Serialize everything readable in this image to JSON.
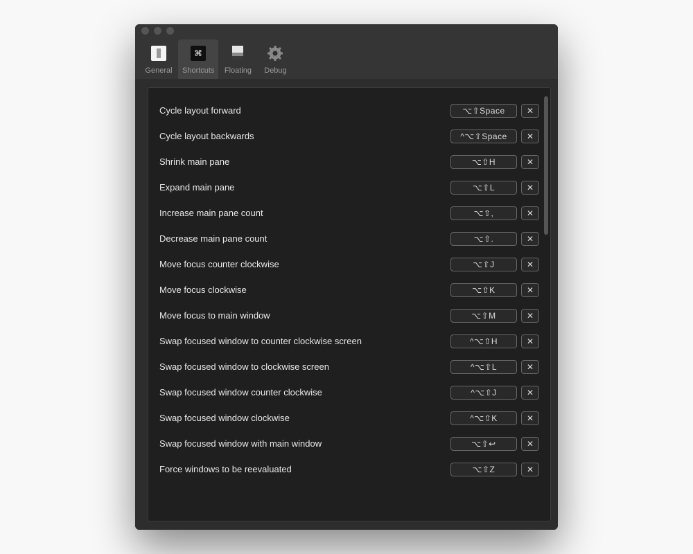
{
  "toolbar": {
    "tabs": [
      {
        "label": "General"
      },
      {
        "label": "Shortcuts"
      },
      {
        "label": "Floating"
      },
      {
        "label": "Debug"
      }
    ],
    "selected_index": 1
  },
  "shortcuts": [
    {
      "label": "Cycle layout forward",
      "keys": "⌥⇧Space"
    },
    {
      "label": "Cycle layout backwards",
      "keys": "^⌥⇧Space"
    },
    {
      "label": "Shrink main pane",
      "keys": "⌥⇧H"
    },
    {
      "label": "Expand main pane",
      "keys": "⌥⇧L"
    },
    {
      "label": "Increase main pane count",
      "keys": "⌥⇧,"
    },
    {
      "label": "Decrease main pane count",
      "keys": "⌥⇧."
    },
    {
      "label": "Move focus counter clockwise",
      "keys": "⌥⇧J"
    },
    {
      "label": "Move focus clockwise",
      "keys": "⌥⇧K"
    },
    {
      "label": "Move focus to main window",
      "keys": "⌥⇧M"
    },
    {
      "label": "Swap focused window to counter clockwise screen",
      "keys": "^⌥⇧H"
    },
    {
      "label": "Swap focused window to clockwise screen",
      "keys": "^⌥⇧L"
    },
    {
      "label": "Swap focused window counter clockwise",
      "keys": "^⌥⇧J"
    },
    {
      "label": "Swap focused window clockwise",
      "keys": "^⌥⇧K"
    },
    {
      "label": "Swap focused window with main window",
      "keys": "⌥⇧↩"
    },
    {
      "label": "Force windows to be reevaluated",
      "keys": "⌥⇧Z"
    }
  ],
  "clear_label": "✕"
}
